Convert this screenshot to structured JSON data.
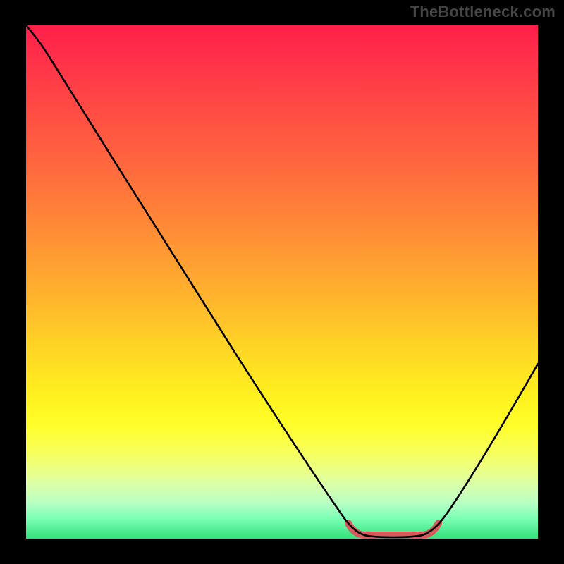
{
  "watermark": "TheBottleneck.com",
  "colors": {
    "frame": "#000000",
    "gradient_top": "#ff1f4a",
    "gradient_bottom": "#34e07a",
    "curve": "#000000",
    "highlight": "#d65a5a"
  },
  "chart_data": {
    "type": "line",
    "title": "",
    "xlabel": "",
    "ylabel": "",
    "xlim": [
      0,
      100
    ],
    "ylim": [
      0,
      100
    ],
    "series": [
      {
        "name": "bottleneck-curve",
        "x": [
          0,
          4,
          8,
          12,
          16,
          20,
          24,
          28,
          32,
          36,
          40,
          44,
          48,
          52,
          56,
          60,
          63,
          66,
          70,
          74,
          78,
          82,
          86,
          90,
          94,
          98,
          100
        ],
        "values": [
          100,
          97,
          92,
          86,
          79,
          72,
          65,
          58,
          51,
          44,
          37,
          30,
          24,
          18,
          12,
          7,
          3,
          1,
          0,
          0,
          1,
          5,
          11,
          18,
          27,
          37,
          43
        ]
      }
    ],
    "annotations": [
      {
        "name": "low-bottleneck-band",
        "x_range": [
          63,
          78
        ],
        "y": 0
      }
    ]
  }
}
